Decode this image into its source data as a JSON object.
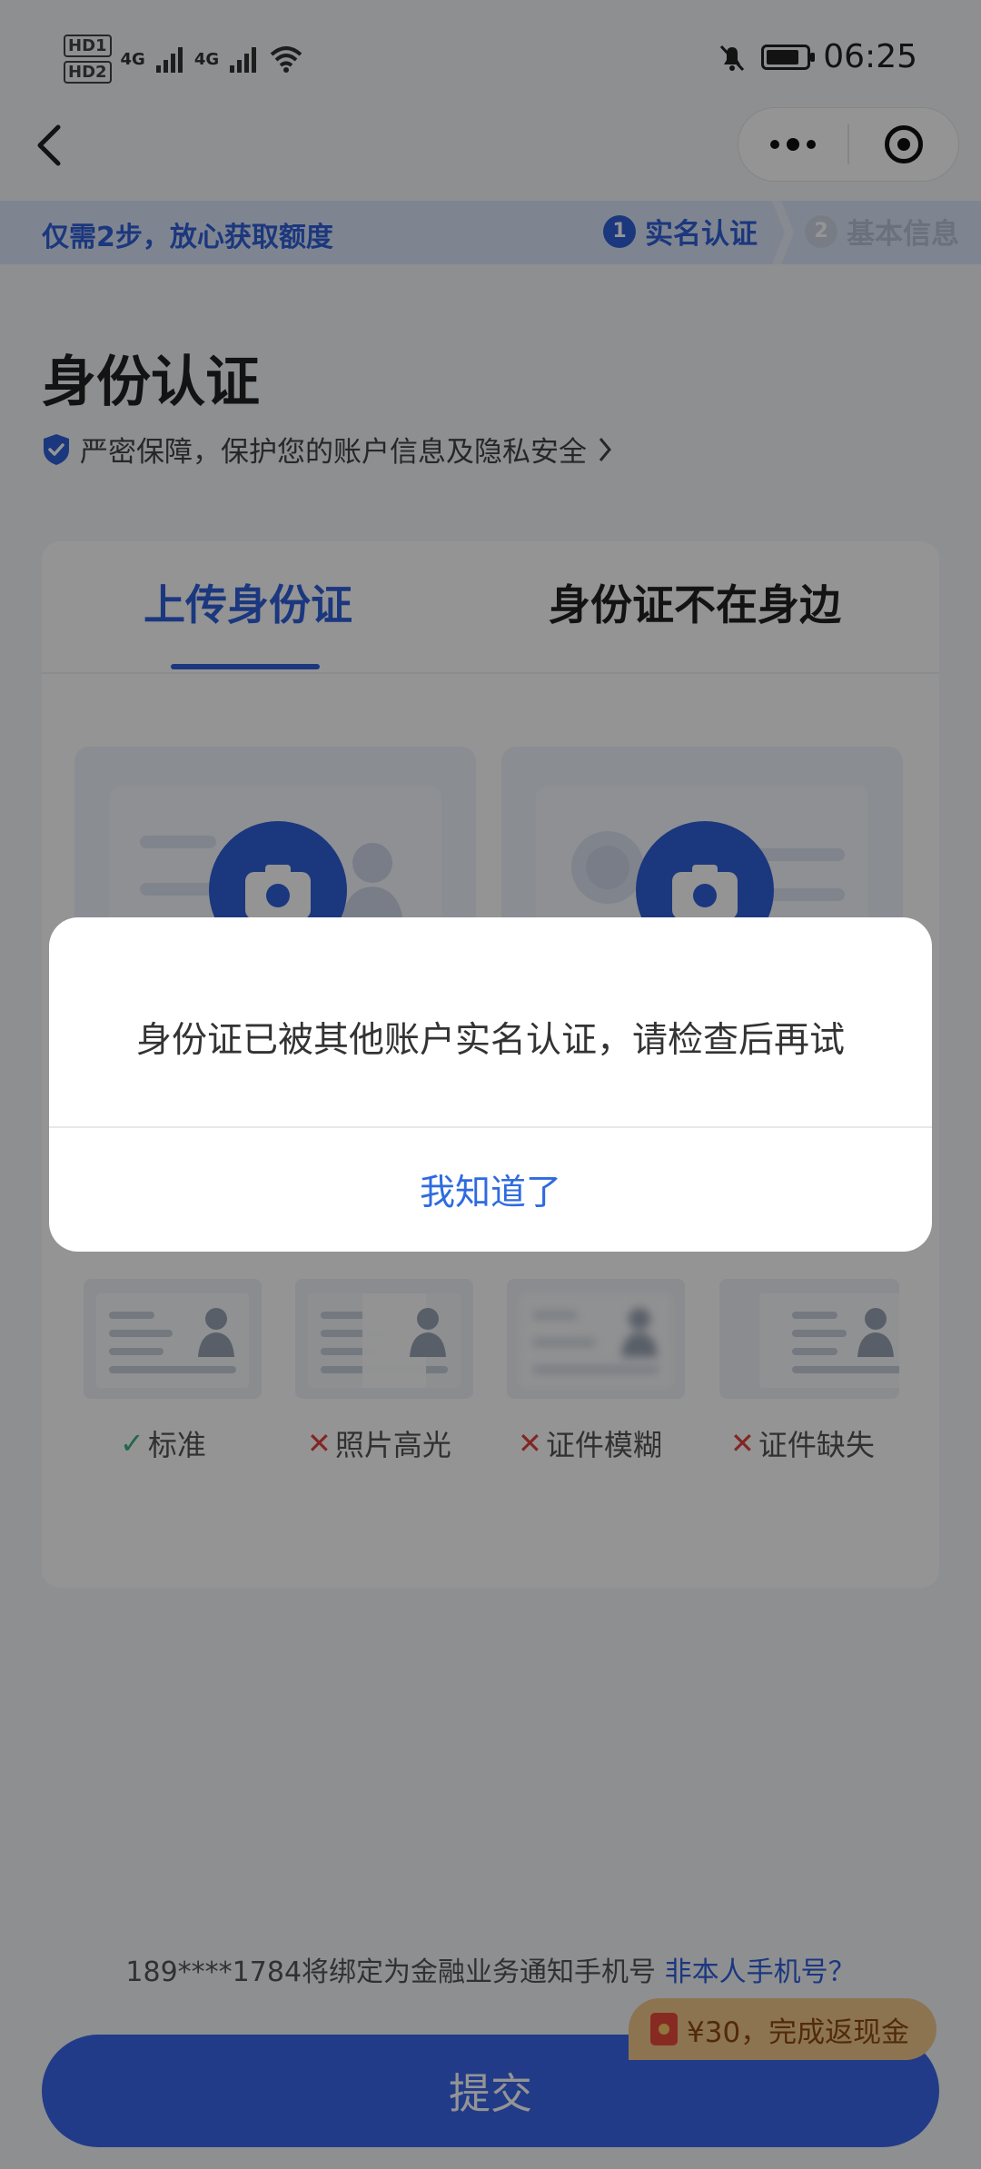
{
  "status_bar": {
    "left_labels": [
      "HD1",
      "HD2",
      "4G",
      "4G"
    ],
    "time": "06:25",
    "icons": [
      "signal-icon",
      "wifi-icon",
      "mute-bell-icon",
      "battery-icon"
    ],
    "battery_level": 0.85
  },
  "nav": {
    "back_icon": "chevron-left-icon",
    "capsule_icons": [
      "more-dots-icon",
      "target-close-icon"
    ]
  },
  "progress": {
    "intro": "仅需2步，放心获取额度",
    "steps": [
      {
        "num": "1",
        "label": "实名认证",
        "active": true
      },
      {
        "num": "2",
        "label": "基本信息",
        "active": false
      }
    ]
  },
  "header": {
    "title": "身份认证",
    "secure_text": "严密保障，保护您的账户信息及隐私安全"
  },
  "tabs": [
    {
      "label": "上传身份证",
      "active": true
    },
    {
      "label": "身份证不在身边",
      "active": false
    }
  ],
  "samples": [
    {
      "label": "标准",
      "ok": true
    },
    {
      "label": "照片高光",
      "ok": false
    },
    {
      "label": "证件模糊",
      "ok": false
    },
    {
      "label": "证件缺失",
      "ok": false
    }
  ],
  "sample_marks": {
    "ok": "✓",
    "bad": "✕"
  },
  "footer": {
    "phone_note": "189****1784将绑定为金融业务通知手机号",
    "phone_link": "非本人手机号？",
    "submit_label": "提交",
    "cashback_badge": "¥30，完成返现金"
  },
  "modal": {
    "message": "身份证已被其他账户实名认证，请检查后再试",
    "button_label": "我知道了"
  },
  "colors": {
    "accent": "#2f5fd9",
    "submit": "#3a67ea",
    "badge": "#f3c98c",
    "ok": "#36b37e",
    "bad": "#e0433d"
  }
}
